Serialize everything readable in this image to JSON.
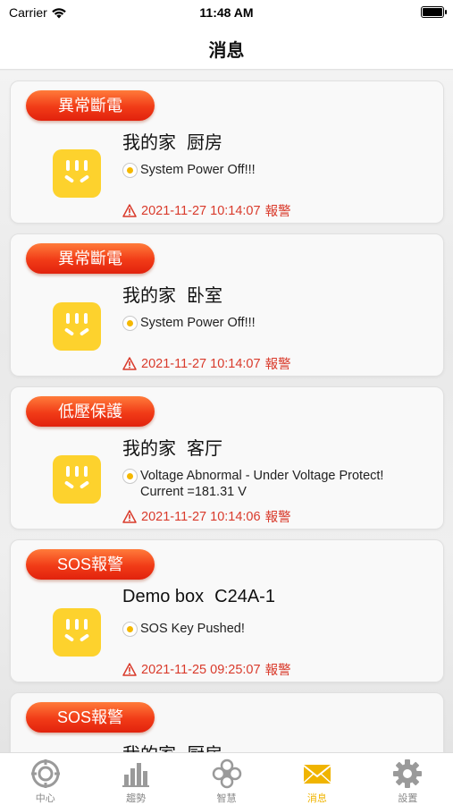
{
  "status_bar": {
    "carrier": "Carrier",
    "time": "11:48 AM"
  },
  "header": {
    "title": "消息"
  },
  "messages": [
    {
      "badge": "異常斷電",
      "home": "我的家",
      "room": "厨房",
      "text": "System Power Off!!!",
      "time": "2021-11-27 10:14:07",
      "level": "報警"
    },
    {
      "badge": "異常斷電",
      "home": "我的家",
      "room": "卧室",
      "text": "System Power Off!!!",
      "time": "2021-11-27 10:14:07",
      "level": "報警"
    },
    {
      "badge": "低壓保護",
      "home": "我的家",
      "room": "客厅",
      "text": "Voltage Abnormal - Under Voltage Protect! Current =181.31 V",
      "time": "2021-11-27 10:14:06",
      "level": "報警"
    },
    {
      "badge": "SOS報警",
      "home": "Demo box",
      "room": "C24A-1",
      "text": "SOS Key Pushed!",
      "time": "2021-11-25 09:25:07",
      "level": "報警"
    },
    {
      "badge": "SOS報警",
      "home": "我的家",
      "room": "厨房"
    }
  ],
  "tabs": [
    {
      "label": "中心",
      "icon": "target-icon"
    },
    {
      "label": "趨勢",
      "icon": "bar-chart-icon"
    },
    {
      "label": "智慧",
      "icon": "flower-icon"
    },
    {
      "label": "消息",
      "icon": "envelope-icon",
      "active": true
    },
    {
      "label": "設置",
      "icon": "gear-icon"
    }
  ],
  "colors": {
    "accent": "#f0b400",
    "badge": "#f13b17",
    "alarm": "#d93a2b",
    "device": "#fdd22d"
  }
}
